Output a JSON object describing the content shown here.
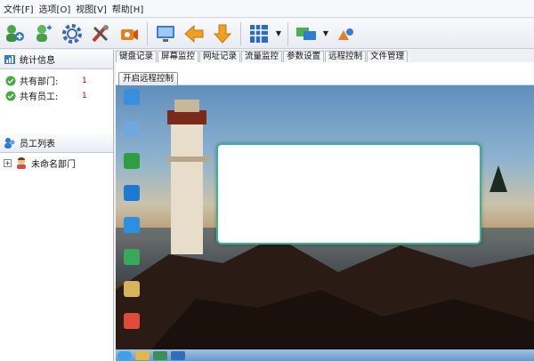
{
  "menu": [
    "文件[F]",
    "选项[O]",
    "视图[V]",
    "帮助[H]"
  ],
  "stats": {
    "title": "统计信息",
    "rows": [
      {
        "label": "共有部门:",
        "value": "1"
      },
      {
        "label": "共有员工:",
        "value": "1"
      }
    ]
  },
  "employees": {
    "title": "员工列表",
    "tree": [
      {
        "label": "未命名部门",
        "expander": "+"
      }
    ]
  },
  "tabs": [
    "键盘记录",
    "屏幕监控",
    "网址记录",
    "流量监控",
    "参数设置",
    "远程控制",
    "文件管理"
  ],
  "active_tab": "屏幕监控",
  "remote_button": "开启远程控制",
  "colors": {
    "dialog_border": "#39b48f",
    "stat_value": "#c00000"
  }
}
